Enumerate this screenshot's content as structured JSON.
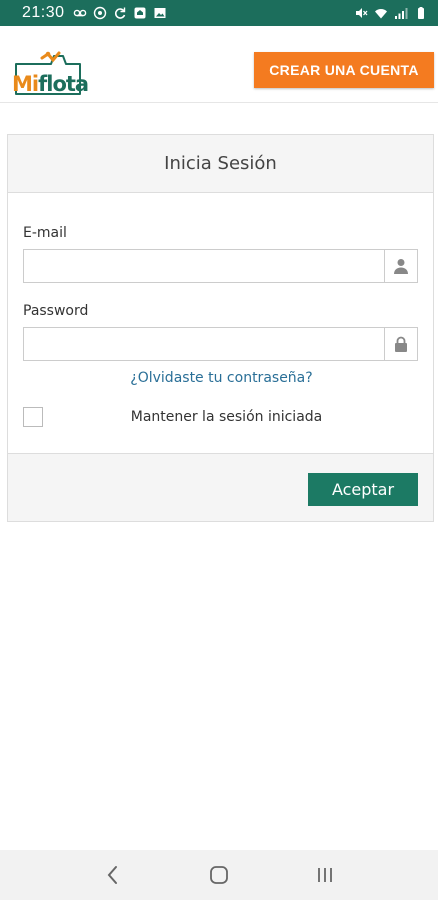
{
  "statusbar": {
    "time": "21:30",
    "colors": {
      "background": "#1c6e5c",
      "text": "#ffffff"
    },
    "left_icons": [
      "voicemail-icon",
      "notification-icon",
      "sync-icon",
      "home-app-icon",
      "image-icon"
    ],
    "right_icons": [
      "mute-icon",
      "wifi-icon",
      "signal-icon",
      "battery-icon"
    ]
  },
  "header": {
    "logo": {
      "mi": "Mi",
      "flota": "flota"
    },
    "create_account_label": "CREAR UNA CUENTA",
    "colors": {
      "cta": "#f47b20",
      "brand_orange": "#e98a1b",
      "brand_green": "#1c6e5c"
    }
  },
  "login": {
    "title": "Inicia Sesión",
    "email": {
      "label": "E-mail",
      "value": "",
      "placeholder": "",
      "icon": "user-icon"
    },
    "password": {
      "label": "Password",
      "value": "",
      "placeholder": "",
      "icon": "lock-icon"
    },
    "forgot_link": "¿Olvidaste tu contraseña?",
    "remember": {
      "label": "Mantener la sesión iniciada",
      "checked": false
    },
    "submit_label": "Aceptar",
    "colors": {
      "submit": "#1c7a64",
      "link": "#2a6f97"
    }
  },
  "navbar": {
    "items": [
      "back-icon",
      "home-icon",
      "recents-icon"
    ]
  }
}
